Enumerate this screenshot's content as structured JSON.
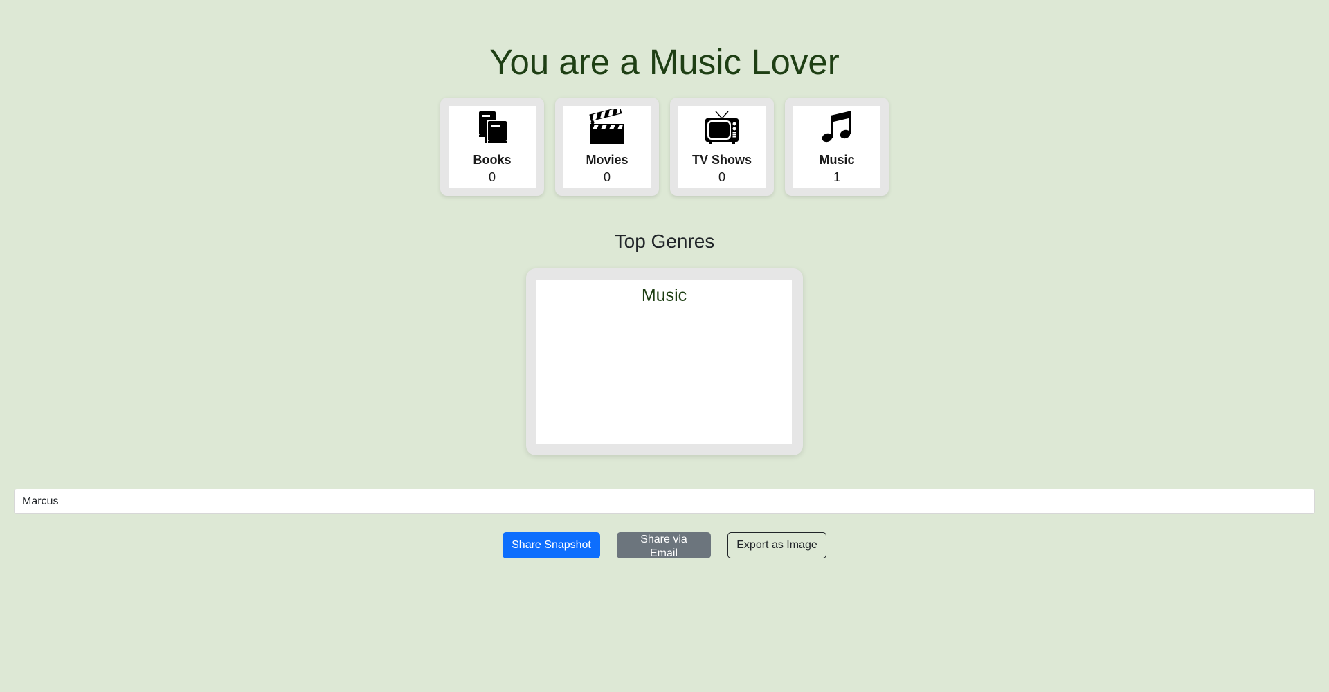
{
  "headline": "You are a Music Lover",
  "stats": [
    {
      "label": "Books",
      "value": "0",
      "icon": "books-icon"
    },
    {
      "label": "Movies",
      "value": "0",
      "icon": "clapperboard-icon"
    },
    {
      "label": "TV Shows",
      "value": "0",
      "icon": "tv-icon"
    },
    {
      "label": "Music",
      "value": "1",
      "icon": "music-note-icon"
    }
  ],
  "top_genres": {
    "title": "Top Genres",
    "items": [
      "Music"
    ]
  },
  "name_field": {
    "value": "Marcus"
  },
  "actions": {
    "share_snapshot": "Share Snapshot",
    "share_email": "Share via Email",
    "export_image": "Export as Image"
  },
  "colors": {
    "background": "#dde8d5",
    "heading_green": "#1e3f14",
    "primary": "#0d6efd",
    "secondary": "#6c757d"
  }
}
